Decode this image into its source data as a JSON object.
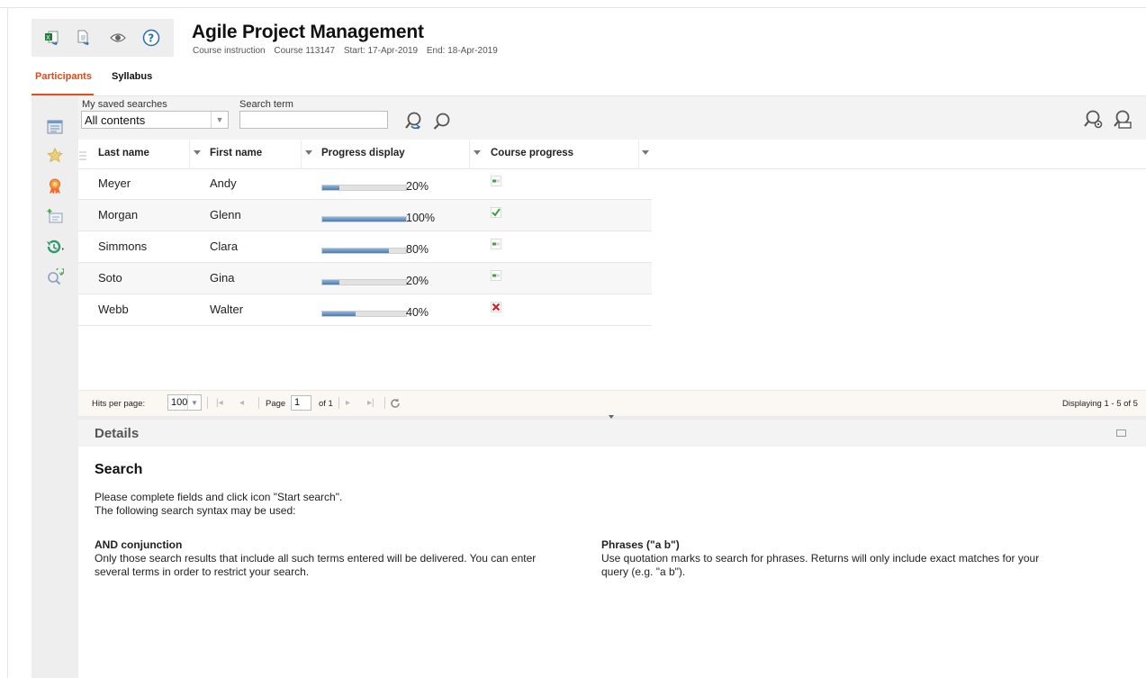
{
  "header": {
    "title": "Agile Project Management",
    "subtitle": {
      "type": "Course instruction",
      "course": "Course 113147",
      "start": "Start: 17-Apr-2019",
      "end": "End: 18-Apr-2019"
    },
    "toolbar_icons": [
      "excel-export-icon",
      "document-export-icon",
      "eye-icon",
      "help-icon"
    ]
  },
  "tabs": [
    {
      "label": "Participants",
      "active": true
    },
    {
      "label": "Syllabus",
      "active": false
    }
  ],
  "rail_icons": [
    "list-view-icon",
    "star-icon",
    "award-icon",
    "add-card-icon",
    "history-icon",
    "search-refresh-icon"
  ],
  "search": {
    "saved_label": "My saved searches",
    "saved_value": "All contents",
    "term_label": "Search term",
    "term_value": ""
  },
  "grid": {
    "columns": [
      "Last name",
      "First name",
      "Progress display",
      "Course progress"
    ],
    "rows": [
      {
        "last": "Meyer",
        "first": "Andy",
        "progress": 20,
        "progress_text": "20%",
        "status": "in-progress"
      },
      {
        "last": "Morgan",
        "first": "Glenn",
        "progress": 100,
        "progress_text": "100%",
        "status": "completed"
      },
      {
        "last": "Simmons",
        "first": "Clara",
        "progress": 80,
        "progress_text": "80%",
        "status": "in-progress"
      },
      {
        "last": "Soto",
        "first": "Gina",
        "progress": 20,
        "progress_text": "20%",
        "status": "in-progress"
      },
      {
        "last": "Webb",
        "first": "Walter",
        "progress": 40,
        "progress_text": "40%",
        "status": "failed"
      }
    ]
  },
  "pager": {
    "hits_label": "Hits per page:",
    "hits_value": "100",
    "page_label": "Page",
    "page_value": "1",
    "of_label": "of 1",
    "display_text": "Displaying 1 - 5 of 5"
  },
  "details": {
    "title": "Details",
    "search_heading": "Search",
    "intro_line1": "Please complete fields and click icon \"Start search\".",
    "intro_line2": "The following search syntax may be used:",
    "and_heading": "AND conjunction",
    "and_text_line1": "Only those search results that include all such terms entered will be delivered. You can enter",
    "and_text_line2": "several terms in order to restrict your search.",
    "phrase_heading": "Phrases (\"a b\")",
    "phrase_text_line1": "Use quotation marks to search for phrases. Returns will only include exact matches for your",
    "phrase_text_line2": "query (e.g. \"a b\")."
  },
  "colors": {
    "accent": "#e04a1a",
    "progress_fill": "#4a7bb5",
    "status_ok": "#3aa53a",
    "status_fail": "#d2232a"
  }
}
